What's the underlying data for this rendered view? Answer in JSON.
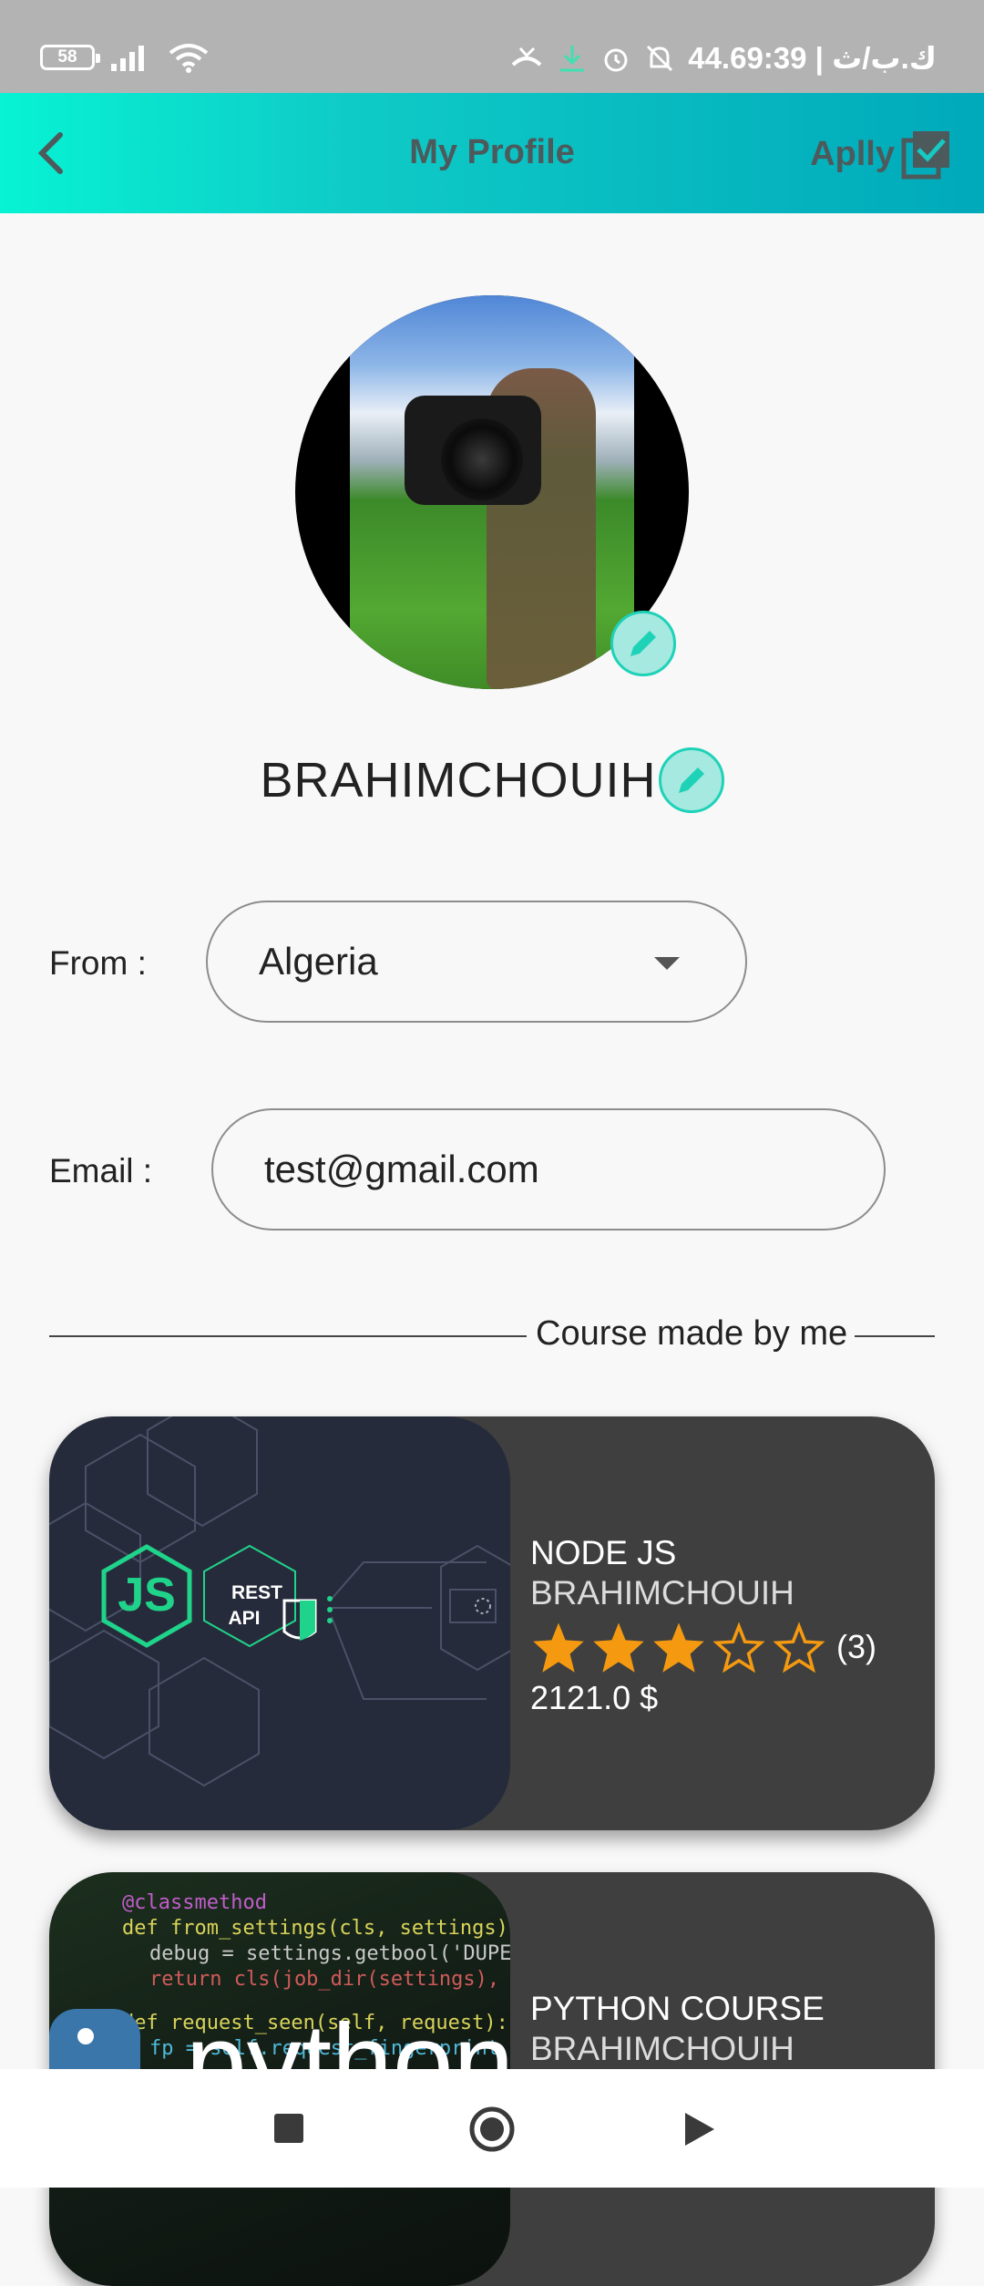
{
  "status_bar": {
    "battery": "58",
    "right_text": "44.6ك.ب/ث | 9:39"
  },
  "header": {
    "title": "My Profile",
    "apply_label": "Aplly"
  },
  "profile": {
    "username": "BRAHIMCHOUIH"
  },
  "form": {
    "from_label": "From :",
    "from_value": "Algeria",
    "email_label": "Email :",
    "email_value": "test@gmail.com"
  },
  "section": {
    "divider_label": "Course made by me"
  },
  "courses": [
    {
      "title": "NODE JS",
      "author": "BRAHIMCHOUIH",
      "rating": 3,
      "max_rating": 5,
      "rating_count": "(3)",
      "price": "2121.0 $",
      "thumb_badge_js": "JS",
      "thumb_badge_rest": "REST",
      "thumb_badge_api": "API"
    },
    {
      "title": "PYTHON COURSE",
      "author": "BRAHIMCHOUIH",
      "thumb_word": "python"
    }
  ],
  "colors": {
    "appbar_start": "#07f3d3",
    "appbar_end": "#00a9ba",
    "accent": "#1ed2b8",
    "star": "#f59a10",
    "card_bg": "#3f3f3f"
  }
}
